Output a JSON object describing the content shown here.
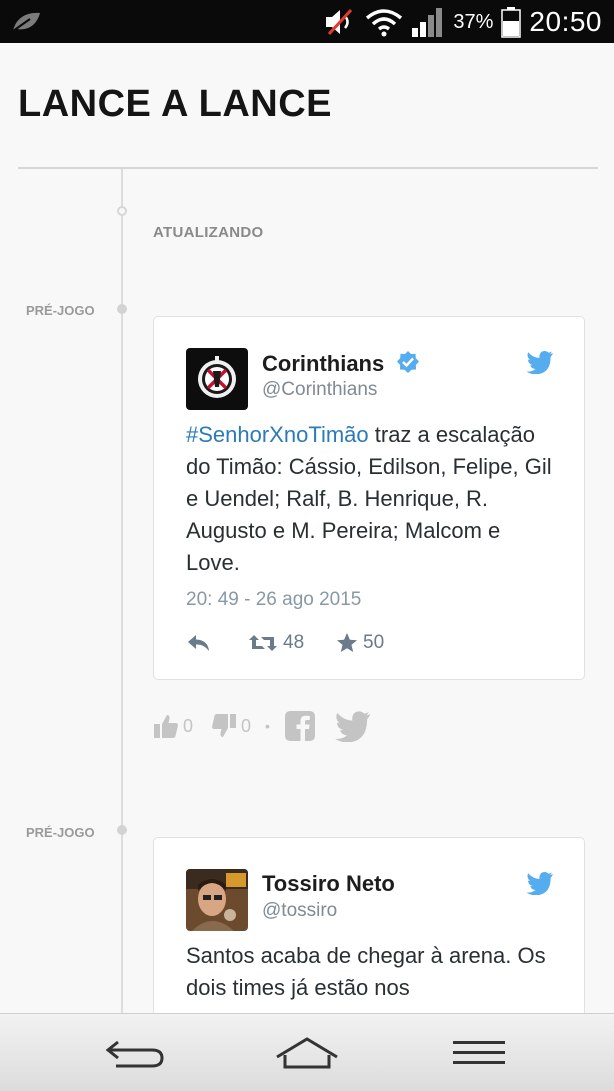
{
  "status_bar": {
    "battery_percent": "37%",
    "time": "20:50",
    "icons": [
      "leaf-icon",
      "mute-icon",
      "wifi-icon",
      "signal-icon",
      "battery-icon"
    ]
  },
  "page": {
    "title": "LANCE A LANCE",
    "updating_label": "ATUALIZANDO"
  },
  "posts": [
    {
      "phase": "PRÉ-JOGO",
      "tweet": {
        "name": "Corinthians",
        "handle": "@Corinthians",
        "verified": true,
        "hashtag": "#SenhorXnoTimão",
        "text": " traz a escalação do Timão: Cássio, Edilson, Felipe, Gil e Uendel; Ralf, B. Henrique, R. Augusto e M. Pereira; Malcom e Love.",
        "date": "20: 49 - 26 ago 2015",
        "retweets": "48",
        "favorites": "50"
      },
      "reactions": {
        "likes": "0",
        "dislikes": "0"
      }
    },
    {
      "phase": "PRÉ-JOGO",
      "tweet": {
        "name": "Tossiro Neto",
        "handle": "@tossiro",
        "verified": false,
        "text": "Santos acaba de chegar à arena. Os dois times já estão nos"
      }
    }
  ],
  "colors": {
    "twitter_blue": "#55acee",
    "hashtag": "#2b7bb9",
    "status_bar_bg": "#0a0a0a"
  }
}
